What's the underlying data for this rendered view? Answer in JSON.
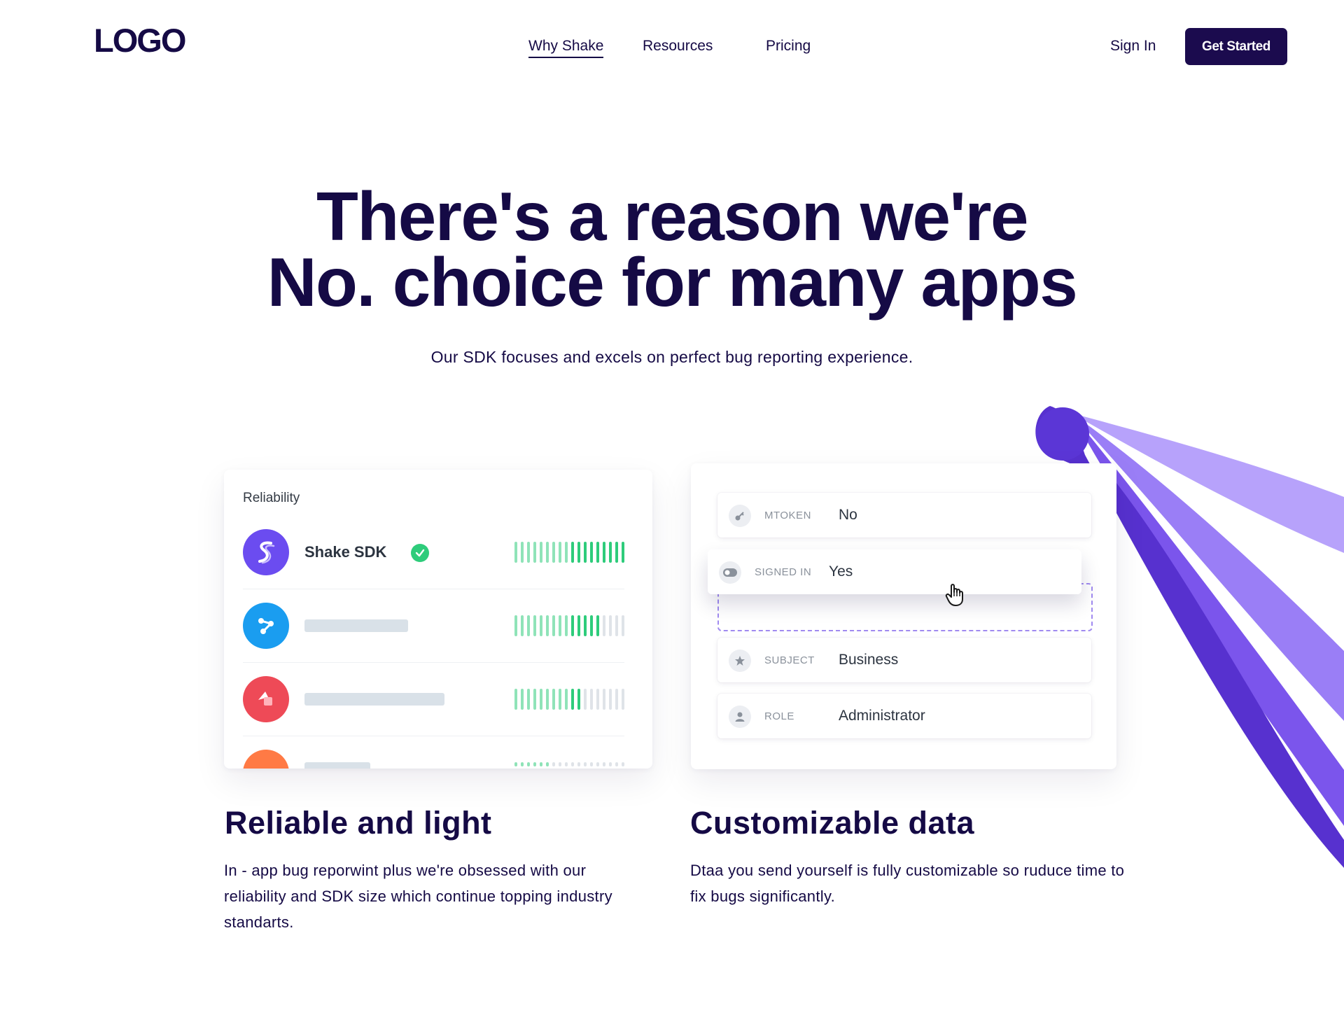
{
  "nav": {
    "logo": "LOGO",
    "links": [
      {
        "label": "Why Shake",
        "active": true
      },
      {
        "label": "Resources",
        "active": false
      },
      {
        "label": "Pricing",
        "active": false
      }
    ],
    "sign_in": "Sign In",
    "get_started": "Get Started"
  },
  "hero": {
    "title_line1": "There's a reason we're",
    "title_line2": "No. choice for many apps",
    "subtitle": "Our SDK focuses and excels on perfect bug reporting experience."
  },
  "reliability_card": {
    "title": "Reliability",
    "rows": [
      {
        "name": "Shake SDK",
        "verified": true,
        "score": 1.0,
        "color": "#6b4cf0",
        "icon": "shake-logo-icon"
      },
      {
        "name": "",
        "verified": false,
        "score": 0.75,
        "color": "#1a9df0",
        "icon": "network-nodes-icon"
      },
      {
        "name": "",
        "verified": false,
        "score": 0.6,
        "color": "#ee4a57",
        "icon": "app-shapes-icon"
      },
      {
        "name": "",
        "verified": false,
        "score": 0.35,
        "color": "#ff7a45",
        "icon": "app-icon"
      }
    ]
  },
  "data_card": {
    "fields": [
      {
        "key": "MTOKEN",
        "value": "No",
        "icon": "key-icon"
      },
      {
        "key": "SIGNED IN",
        "value": "Yes",
        "icon": "toggle-icon"
      },
      {
        "key": "SUBJECT",
        "value": "Business",
        "icon": "star-icon"
      },
      {
        "key": "ROLE",
        "value": "Administrator",
        "icon": "user-icon"
      }
    ]
  },
  "features": [
    {
      "title": "Reliable and light",
      "body": "In - app bug reporwint plus we're obsessed with our reliability and SDK size which continue topping industry standarts."
    },
    {
      "title": "Customizable data",
      "body": "Dtaa you send yourself is fully customizable so ruduce time to fix bugs significantly."
    }
  ],
  "colors": {
    "brand_dark": "#150a45",
    "accent_purple": "#6b4cf0",
    "bar_green": "#2ecc7b",
    "bar_gray": "#dfe3e8"
  }
}
